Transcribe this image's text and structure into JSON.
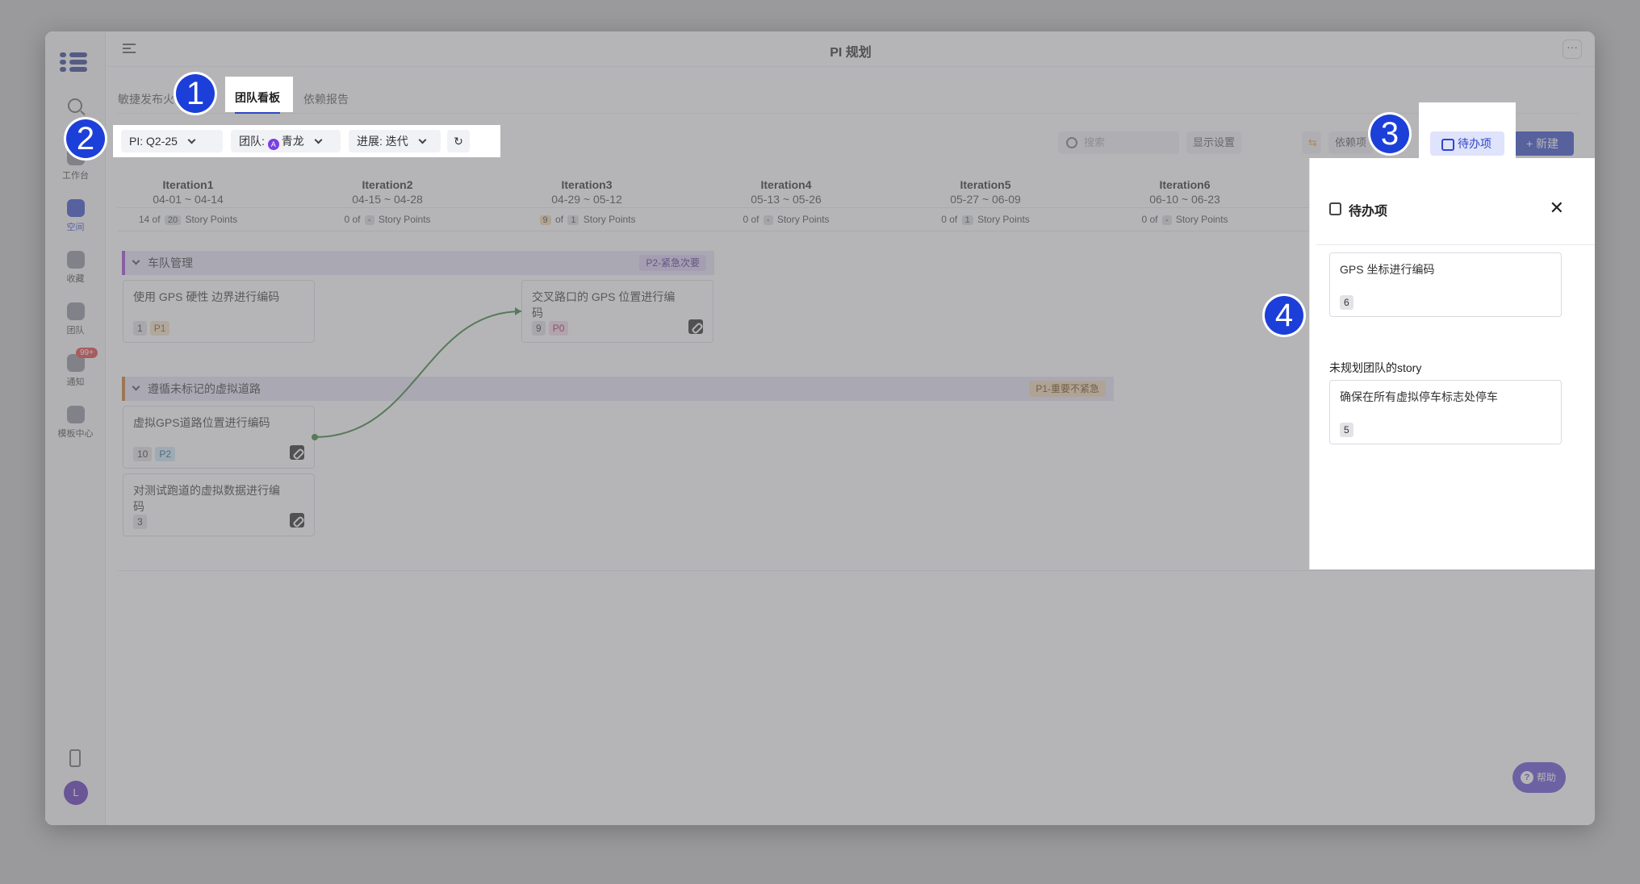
{
  "app": {
    "title": "PI 规划",
    "more_label": "···",
    "rail": [
      {
        "label": "工作台"
      },
      {
        "label": "空间"
      },
      {
        "label": "收藏"
      },
      {
        "label": "团队"
      },
      {
        "label": "通知",
        "badge": "99+"
      },
      {
        "label": "模板中心"
      }
    ],
    "avatar": "L"
  },
  "tabs": [
    {
      "label": "敏捷发布火"
    },
    {
      "label": "团队看板"
    },
    {
      "label": "依赖报告"
    }
  ],
  "filters": {
    "pi_label": "PI:",
    "pi_value": "Q2-25",
    "team_label": "团队:",
    "team_value": "青龙",
    "team_icon_letter": "A",
    "progress_label": "进展:",
    "progress_value": "迭代",
    "refresh_icon": "↻"
  },
  "toolbar": {
    "search_placeholder": "搜索",
    "display_settings": "显示设置",
    "dependency": "依赖项",
    "backlog": "待办项",
    "new": "+ 新建"
  },
  "iterations": [
    {
      "name": "Iteration1",
      "dates": "04-01 ~ 04-14",
      "done": "14",
      "total": "20"
    },
    {
      "name": "Iteration2",
      "dates": "04-15 ~ 04-28",
      "done": "0",
      "total": "-"
    },
    {
      "name": "Iteration3",
      "dates": "04-29 ~ 05-12",
      "done": "9",
      "total": "1"
    },
    {
      "name": "Iteration4",
      "dates": "05-13 ~ 05-26",
      "done": "0",
      "total": "-"
    },
    {
      "name": "Iteration5",
      "dates": "05-27 ~ 06-09",
      "done": "0",
      "total": "1"
    },
    {
      "name": "Iteration6",
      "dates": "06-10 ~ 06-23",
      "done": "0",
      "total": "-"
    }
  ],
  "sp_text": {
    "of": "of",
    "unit": "Story Points"
  },
  "groups": [
    {
      "name": "车队管理",
      "priority": "P2-紧急次要",
      "cards": [
        {
          "title": "使用 GPS 硬性 边界进行编码",
          "points": "1",
          "prio": "P1"
        },
        {
          "title": "交叉路口的 GPS 位置进行编码",
          "points": "9",
          "prio": "P0"
        }
      ]
    },
    {
      "name": "遵循未标记的虚拟道路",
      "priority": "P1-重要不紧急",
      "cards": [
        {
          "title": "虚拟GPS道路位置进行编码",
          "points": "10",
          "prio": "P2"
        },
        {
          "title": "对测试跑道的虚拟数据进行编码",
          "points": "3"
        }
      ]
    }
  ],
  "panel": {
    "title": "待办项",
    "close": "✕",
    "items": [
      {
        "title": "GPS 坐标进行编码",
        "points": "6"
      }
    ],
    "section": "未规划团队的story",
    "section_items": [
      {
        "title": "确保在所有虚拟停车标志处停车",
        "points": "5"
      }
    ]
  },
  "help": "帮助",
  "callouts": [
    "1",
    "2",
    "3",
    "4"
  ],
  "colors": {
    "accent": "#2f46c7",
    "link_line": "#2e7d32"
  }
}
